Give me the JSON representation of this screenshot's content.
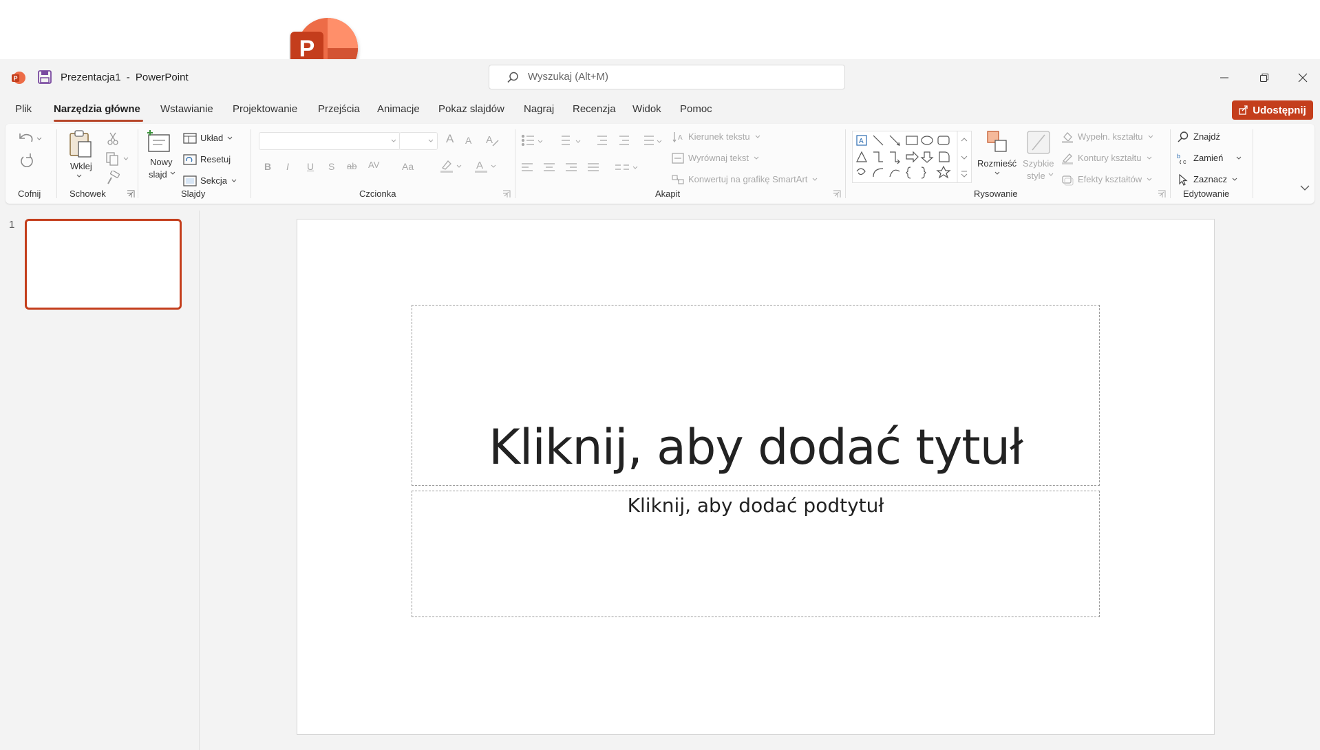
{
  "window": {
    "doc_name": "Prezentacja1",
    "separator": "-",
    "app_name": "PowerPoint"
  },
  "search": {
    "placeholder": "Wyszukaj (Alt+M)"
  },
  "tabs": [
    {
      "label": "Plik"
    },
    {
      "label": "Narzędzia główne"
    },
    {
      "label": "Wstawianie"
    },
    {
      "label": "Projektowanie"
    },
    {
      "label": "Przejścia"
    },
    {
      "label": "Animacje"
    },
    {
      "label": "Pokaz slajdów"
    },
    {
      "label": "Nagraj"
    },
    {
      "label": "Recenzja"
    },
    {
      "label": "Widok"
    },
    {
      "label": "Pomoc"
    }
  ],
  "share": {
    "label": "Udostępnij"
  },
  "ribbon": {
    "groups": {
      "undo": "Cofnij",
      "clipboard": "Schowek",
      "slides": "Slajdy",
      "font": "Czcionka",
      "paragraph": "Akapit",
      "drawing": "Rysowanie",
      "editing": "Edytowanie"
    },
    "clipboard": {
      "paste": "Wklej"
    },
    "slides": {
      "new_slide_1": "Nowy",
      "new_slide_2": "slajd",
      "layout": "Układ",
      "reset": "Resetuj",
      "section": "Sekcja"
    },
    "font": {
      "grow": "A",
      "shrink": "A",
      "bold": "B",
      "italic": "I",
      "underline": "U",
      "shadow": "S",
      "strike": "ab",
      "spacing": "AV",
      "case": "Aa",
      "color": "A"
    },
    "paragraph": {
      "text_direction": "Kierunek tekstu",
      "align_text": "Wyrównaj tekst",
      "smartart": "Konwertuj na grafikę SmartArt"
    },
    "drawing": {
      "arrange": "Rozmieść",
      "quick_styles_1": "Szybkie",
      "quick_styles_2": "style",
      "fill": "Wypełn. kształtu",
      "outline": "Kontury kształtu",
      "effects": "Efekty kształtów"
    },
    "editing": {
      "find": "Znajdź",
      "replace": "Zamień",
      "select": "Zaznacz"
    }
  },
  "thumbnails": [
    {
      "number": "1"
    }
  ],
  "slide": {
    "title_placeholder": "Kliknij, aby dodać tytuł",
    "subtitle_placeholder": "Kliknij, aby dodać podtytuł"
  },
  "colors": {
    "accent": "#c43e1c",
    "tab_underline": "#b7472a",
    "logo_dark": "#c43e1c",
    "logo_light": "#ed6c47"
  }
}
